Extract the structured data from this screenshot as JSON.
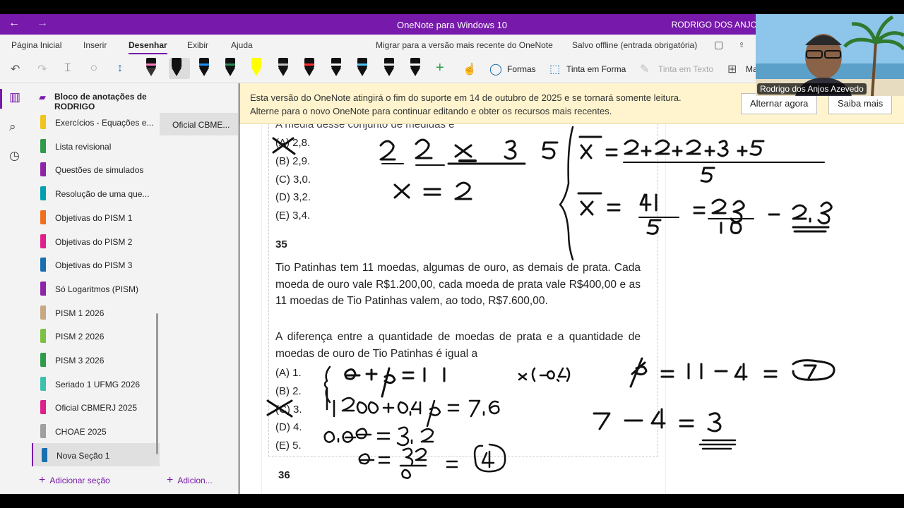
{
  "window": {
    "title": "OneNote para Windows 10",
    "user": "RODRIGO DOS ANJOS",
    "back_icon": "arrow-left-icon",
    "forward_icon": "arrow-right-icon"
  },
  "menu": {
    "tabs": [
      "Página Inicial",
      "Inserir",
      "Desenhar",
      "Exibir",
      "Ajuda"
    ],
    "active_tab": "Desenhar",
    "migrate": "Migrar para a versão mais recente do OneNote",
    "offline": "Salvo offline (entrada obrigatória)"
  },
  "toolbar": {
    "formas": "Formas",
    "tinta_em_forma": "Tinta em Forma",
    "tinta_em_texto": "Tinta em Texto",
    "more": "Ma",
    "pen_colors": [
      "#ff80c0",
      "#1e90ff",
      "#2e8b57",
      "#ffff00",
      "#c0c0c0",
      "#ff3030",
      "#ffffff",
      "#4fc3f7",
      "#eeeeee",
      "#ffffff"
    ]
  },
  "notebook": {
    "title": "Bloco de anotações de RODRIGO",
    "sections": [
      {
        "label": "Exercícios - Equações e...",
        "color": "#f0c419"
      },
      {
        "label": "Lista revisional",
        "color": "#2e9c4a"
      },
      {
        "label": "Questões de simulados",
        "color": "#8e24aa"
      },
      {
        "label": "Resolução de uma que...",
        "color": "#00a0b0"
      },
      {
        "label": "Objetivas do PISM 1",
        "color": "#f07020"
      },
      {
        "label": "Objetivas do PISM 2",
        "color": "#e0208a"
      },
      {
        "label": "Objetivas do PISM 3",
        "color": "#1a6fb0"
      },
      {
        "label": "Só Logaritmos (PISM)",
        "color": "#8e24aa"
      },
      {
        "label": "PISM 1 2026",
        "color": "#c8a882"
      },
      {
        "label": "PISM 2 2026",
        "color": "#7cc242"
      },
      {
        "label": "PISM 3 2026",
        "color": "#2e9c4a"
      },
      {
        "label": "Seriado 1 UFMG 2026",
        "color": "#3cc0b0"
      },
      {
        "label": "Oficial CBMERJ 2025",
        "color": "#e0208a"
      },
      {
        "label": "CHOAE 2025",
        "color": "#a0a0a0"
      },
      {
        "label": "Nova Seção 1",
        "color": "#1a6fb0"
      }
    ],
    "add_section": "Adicionar seção",
    "page": "Oficial CBME...",
    "add_page": "Adicion..."
  },
  "notice": {
    "line1": "Esta versão do OneNote atingirá o fim do suporte em 14 de outubro de 2025 e se tornará somente leitura.",
    "line2": "Alterne para o novo OneNote para continuar editando e obter os recursos mais recentes.",
    "switch_button": "Alternar agora",
    "learn_button": "Saiba mais"
  },
  "content": {
    "q34_top": "A média desse conjunto de medidas é",
    "q34_options": [
      "(A) 2,8.",
      "(B) 2,9.",
      "(C) 3,0.",
      "(D) 3,2.",
      "(E) 3,4."
    ],
    "q35_number": "35",
    "q35_text1": "Tio Patinhas tem 11 moedas, algumas de ouro, as demais de prata. Cada moeda de ouro vale R$1.200,00, cada moeda de prata vale R$400,00 e as 11 moedas de Tio Patinhas valem, ao todo, R$7.600,00.",
    "q35_text2": "A diferença entre a quantidade de moedas de prata e a quantidade de moedas de ouro de Tio Patinhas é igual a",
    "q35_options": [
      "(A) 1.",
      "(B) 2.",
      "(C) 3.",
      "(D) 4.",
      "(E) 5."
    ],
    "q36_number": "36"
  },
  "webcam": {
    "name": "Rodrigo dos Anjos Azevedo"
  }
}
